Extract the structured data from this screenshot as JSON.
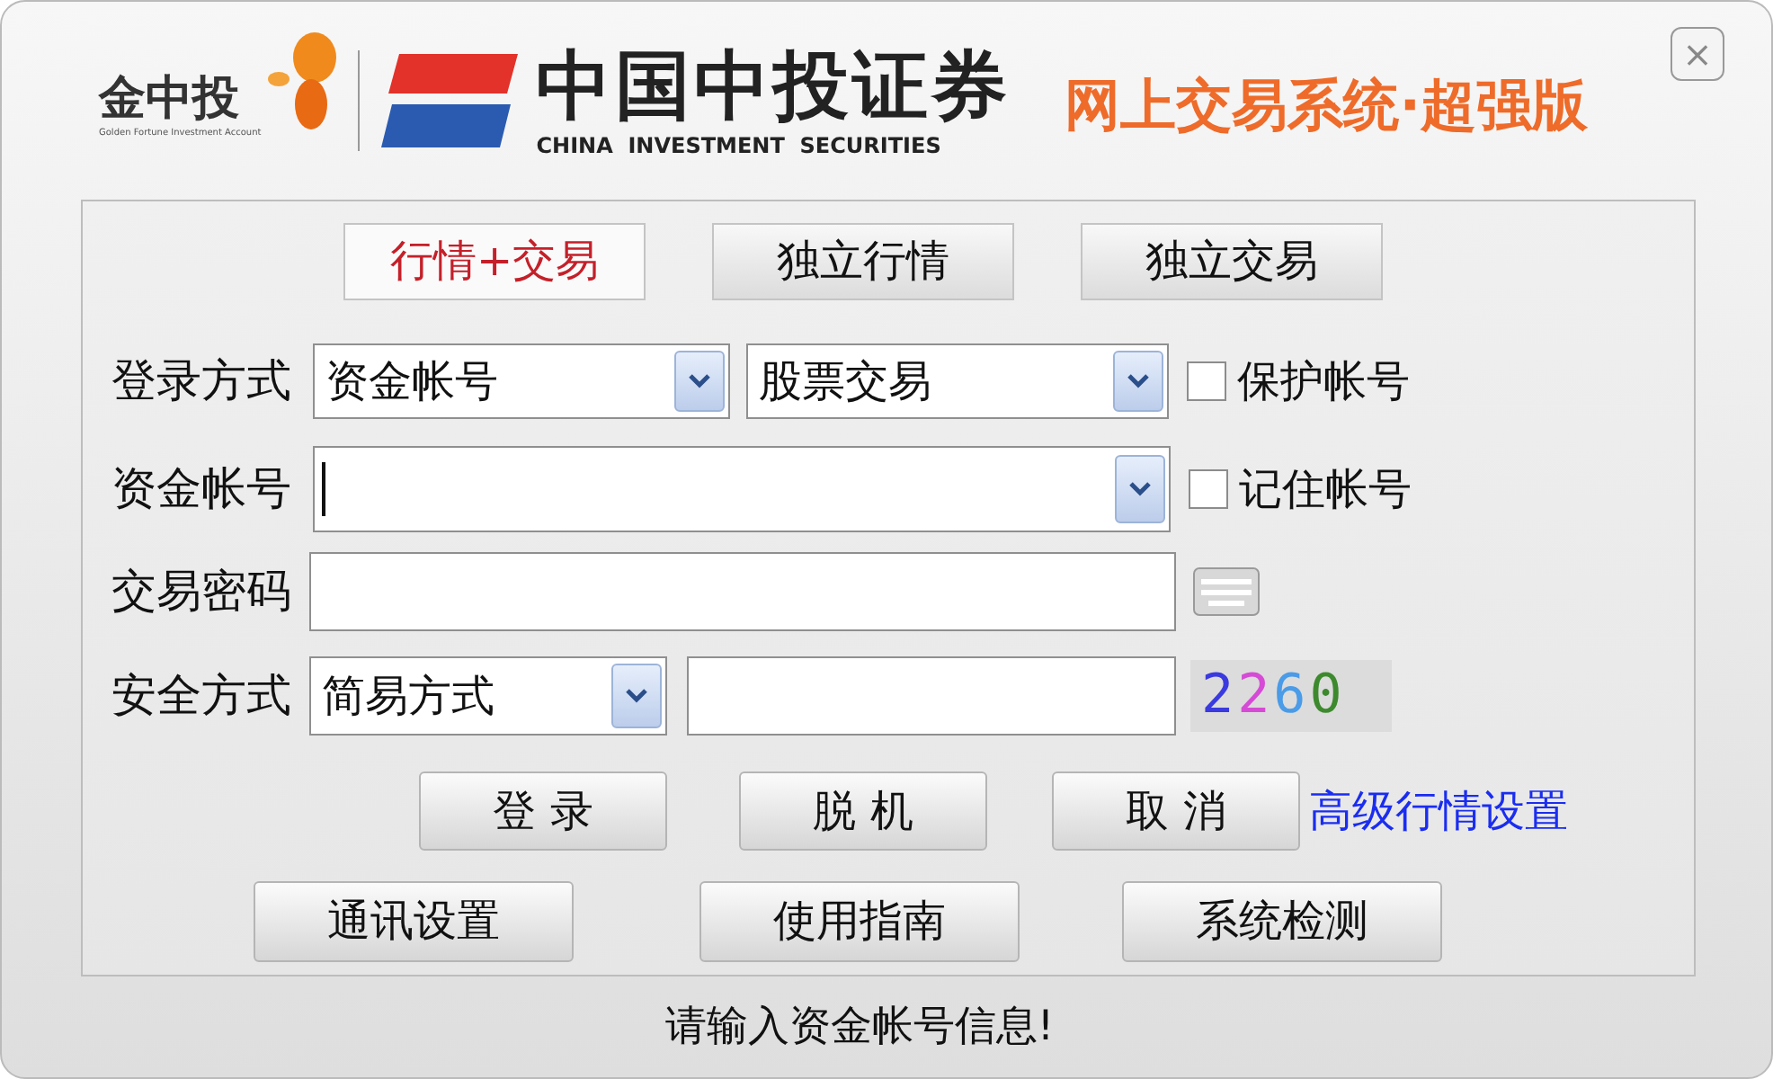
{
  "header": {
    "brand_small": "金中投",
    "brand_small_tagline": "Golden Fortune Investment Account",
    "brand_main": "中国中投证券",
    "brand_main_english": "CHINA  INVESTMENT  SECURITIES",
    "product_title": "网上交易系统·超强版",
    "close_label": "×"
  },
  "mode_tabs": [
    {
      "label": "行情+交易",
      "selected": true
    },
    {
      "label": "独立行情",
      "selected": false
    },
    {
      "label": "独立交易",
      "selected": false
    }
  ],
  "login_method": {
    "label": "登录方式",
    "account_type": "资金帐号",
    "trade_type": "股票交易",
    "protect": {
      "label": "保护帐号",
      "checked": false
    }
  },
  "account": {
    "label": "资金帐号",
    "remember": {
      "label": "记住帐号",
      "checked": false
    }
  },
  "password": {
    "label": "交易密码"
  },
  "security": {
    "label": "安全方式",
    "method": "简易方式",
    "captcha": [
      {
        "char": "2",
        "color": "#3a3ae0"
      },
      {
        "char": "2",
        "color": "#d64bd6"
      },
      {
        "char": "6",
        "color": "#4a9be8"
      },
      {
        "char": "0",
        "color": "#3d8a2e"
      }
    ]
  },
  "actions": [
    "登 录",
    "脱 机",
    "取 消"
  ],
  "advanced_link": "高级行情设置",
  "tools": [
    "通讯设置",
    "使用指南",
    "系统检测"
  ],
  "status": "请输入资金帐号信息!"
}
